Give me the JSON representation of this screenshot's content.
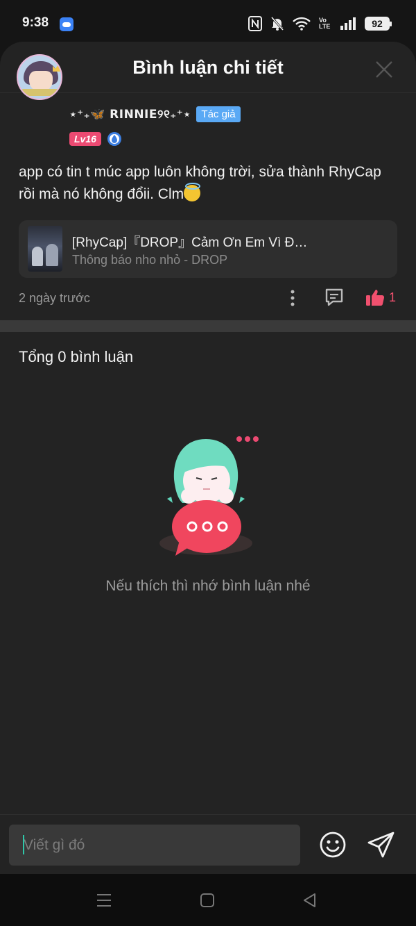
{
  "status_bar": {
    "time": "9:38",
    "battery": "92",
    "network": "Vo LTE"
  },
  "header": {
    "title": "Bình luận chi tiết"
  },
  "post": {
    "username": "⋆⁺₊🦋 RINNIE୨୧₊⁺⋆",
    "author_badge": "Tác giả",
    "level": "Lv16",
    "text": "app có tin t múc app luôn không trời, sửa thành RhyCap rồi mà nó không đổii. Clm",
    "linked_song": {
      "title": "[RhyCap]『DROP』Cảm Ơn Em Vì Đ…",
      "subtitle": "Thông báo nho nhỏ - DROP"
    },
    "time_ago": "2 ngày trước",
    "like_count": "1"
  },
  "comments": {
    "total_label": "Tổng 0 bình luận",
    "empty_message": "Nếu thích thì nhớ bình luận nhé"
  },
  "input": {
    "placeholder": "Viết gì đó"
  },
  "colors": {
    "accent_pink": "#ec4a72",
    "author_blue": "#5aa9f5",
    "like_red": "#f0506e",
    "caret_teal": "#2fc6a8"
  }
}
